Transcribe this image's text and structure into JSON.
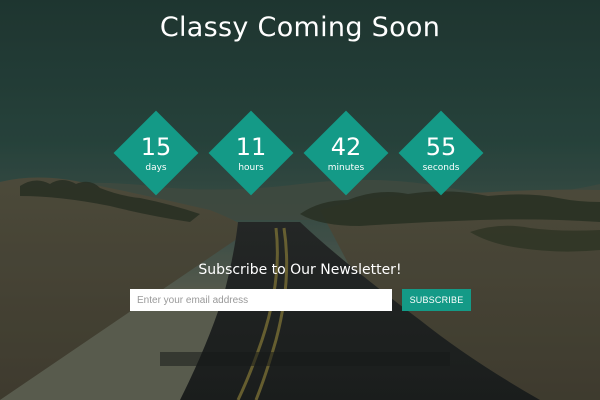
{
  "page": {
    "title": "Classy Coming Soon"
  },
  "countdown": [
    {
      "value": "15",
      "unit": "days"
    },
    {
      "value": "11",
      "unit": "hours"
    },
    {
      "value": "42",
      "unit": "minutes"
    },
    {
      "value": "55",
      "unit": "seconds"
    }
  ],
  "newsletter": {
    "heading": "Subscribe to Our Newsletter!",
    "email_placeholder": "Enter your email address",
    "email_value": "",
    "subscribe_label": "SUBSCRIBE"
  },
  "colors": {
    "accent": "#149a87",
    "text": "#ffffff"
  }
}
